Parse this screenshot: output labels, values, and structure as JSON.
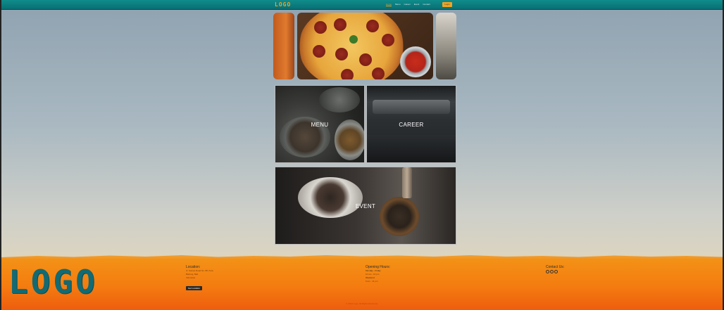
{
  "nav": {
    "logo": "LOGO",
    "links": [
      "Home",
      "Menu",
      "Career",
      "Event",
      "Contact"
    ],
    "active_index": 0,
    "button_label": "Login"
  },
  "cards": {
    "menu_label": "MENU",
    "career_label": "CAREER",
    "event_label": "EVENT"
  },
  "footer": {
    "logo": "LOGO",
    "location": {
      "heading": "Location:",
      "lines": [
        "Jl. Sunset Road No. 88, Kuta",
        "Badung, Bali",
        "Indonesia"
      ],
      "button_label": "Get Location"
    },
    "hours": {
      "heading": "Opening Hours:",
      "lines": [
        "Monday - Friday",
        "10 am - 10 pm",
        "Weekend",
        "9 am - 11 pm"
      ]
    },
    "contact": {
      "heading": "Contact Us:",
      "icons": [
        "whatsapp-icon",
        "mail-icon",
        "instagram-icon"
      ]
    },
    "copyright": "© 2024 Logo. All Rights Reserved."
  },
  "colors": {
    "nav_teal": "#0f8c8c",
    "accent_orange": "#f2a321",
    "footer_orange": "#f47b10",
    "logo_teal": "#136a72"
  }
}
